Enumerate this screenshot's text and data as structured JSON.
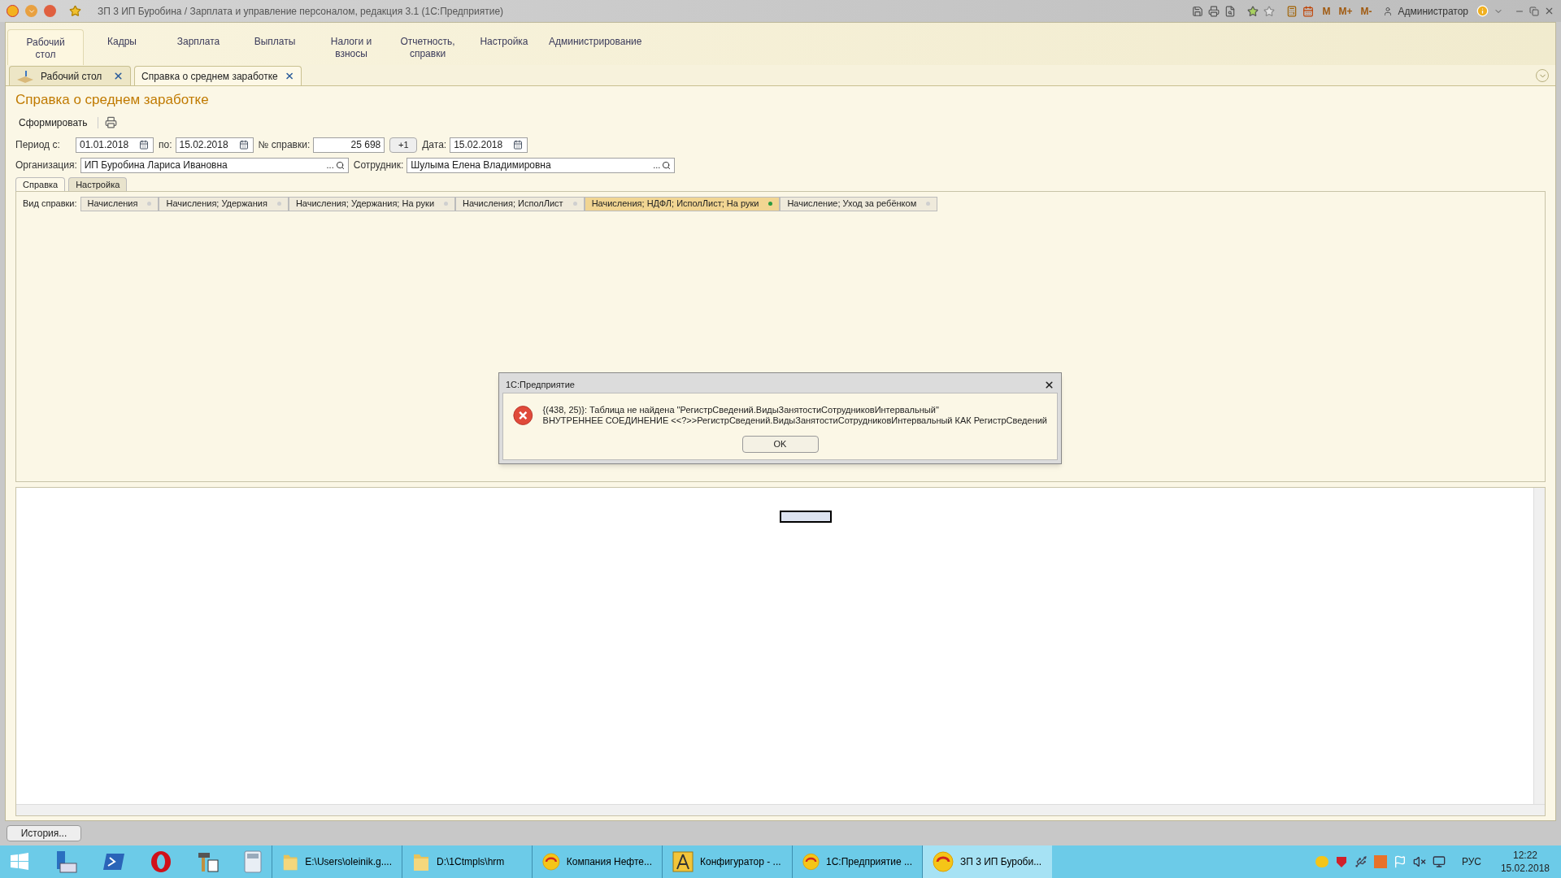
{
  "window": {
    "title": "ЗП 3 ИП Буробина / Зарплата и управление персоналом, редакция 3.1  (1С:Предприятие)",
    "user": "Администратор",
    "memory_buttons": [
      "M",
      "M+",
      "M-"
    ]
  },
  "sections": [
    {
      "lines": [
        "Рабочий",
        "стол"
      ],
      "selected": true
    },
    {
      "lines": [
        "Кадры"
      ],
      "selected": false
    },
    {
      "lines": [
        "Зарплата"
      ],
      "selected": false
    },
    {
      "lines": [
        "Выплаты"
      ],
      "selected": false
    },
    {
      "lines": [
        "Налоги и",
        "взносы"
      ],
      "selected": false
    },
    {
      "lines": [
        "Отчетность,",
        "справки"
      ],
      "selected": false
    },
    {
      "lines": [
        "Настройка"
      ],
      "selected": false
    },
    {
      "lines": [
        "Администрирование"
      ],
      "selected": false
    }
  ],
  "open_tabs": [
    {
      "label": "Рабочий стол",
      "selected": false,
      "kind": "desktop"
    },
    {
      "label": "Справка о среднем заработке",
      "selected": true,
      "kind": "form"
    }
  ],
  "form": {
    "title": "Справка о среднем заработке",
    "generate_button": "Сформировать",
    "period_from": {
      "label": "Период с:",
      "value": "01.01.2018"
    },
    "period_to": {
      "label": "по:",
      "value": "15.02.2018"
    },
    "number": {
      "label": "№ справки:",
      "value": "25 698"
    },
    "increment_button": "+1",
    "date": {
      "label": "Дата:",
      "value": "15.02.2018"
    },
    "organization": {
      "label": "Организация:",
      "value": "ИП Буробина Лариса Ивановна",
      "select_button": "..."
    },
    "employee": {
      "label": "Сотрудник:",
      "value": "Шулыма Елена Владимировна",
      "select_button": "..."
    },
    "tabs": [
      {
        "label": "Справка",
        "selected": true
      },
      {
        "label": "Настройка",
        "selected": false
      }
    ],
    "variant_label": "Вид справки:",
    "variants": [
      {
        "label": "Начисления",
        "selected": false
      },
      {
        "label": "Начисления; Удержания",
        "selected": false
      },
      {
        "label": "Начисления; Удержания; На руки",
        "selected": false
      },
      {
        "label": "Начисления; ИсполЛист",
        "selected": false
      },
      {
        "label": "Начисления; НДФЛ; ИсполЛист; На руки",
        "selected": true
      },
      {
        "label": "Начисление; Уход за ребёнком",
        "selected": false
      }
    ]
  },
  "dialog": {
    "title": "1С:Предприятие",
    "message": [
      "{(438, 25)}: Таблица не найдена \"РегистрСведений.ВидыЗанятостиСотрудниковИнтервальный\"",
      "ВНУТРЕННЕЕ СОЕДИНЕНИЕ <<?>>РегистрСведений.ВидыЗанятостиСотрудниковИнтервальный КАК РегистрСведений"
    ],
    "ok_button": "OK"
  },
  "history_button": "История...",
  "taskbar": {
    "windows": [
      {
        "label": "E:\\Users\\oleinik.g....",
        "kind": "folder",
        "selected": false
      },
      {
        "label": "D:\\1Ctmpls\\hrm",
        "kind": "folder",
        "selected": false
      },
      {
        "label": "Компания Нефте...",
        "kind": "logo",
        "selected": false
      },
      {
        "label": "Конфигуратор - ...",
        "kind": "compass",
        "selected": false
      },
      {
        "label": "1С:Предприятие ...",
        "kind": "logo",
        "selected": false
      },
      {
        "label": "ЗП 3 ИП Буроби...",
        "kind": "logo",
        "selected": true
      }
    ],
    "language": "РУС",
    "time": "12:22",
    "date": "15.02.2018"
  }
}
